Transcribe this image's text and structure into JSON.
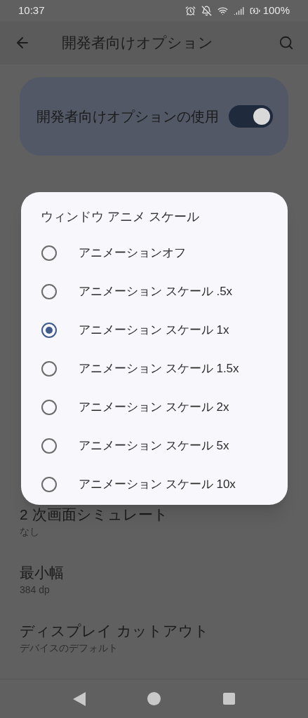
{
  "status_bar": {
    "time": "10:37",
    "battery": "100%"
  },
  "app_bar": {
    "title": "開発者向けオプション"
  },
  "main_switch": {
    "label": "開発者向けオプションの使用",
    "on": true
  },
  "settings": [
    {
      "title": "2 次画面シミュレート",
      "summary": "なし"
    },
    {
      "title": "最小幅",
      "summary": "384 dp"
    },
    {
      "title": "ディスプレイ カットアウト",
      "summary": "デバイスのデフォルト"
    }
  ],
  "dialog": {
    "title": "ウィンドウ アニメ スケール",
    "options": [
      {
        "label": "アニメーションオフ",
        "selected": false
      },
      {
        "label": "アニメーション スケール .5x",
        "selected": false
      },
      {
        "label": "アニメーション スケール 1x",
        "selected": true
      },
      {
        "label": "アニメーション スケール 1.5x",
        "selected": false
      },
      {
        "label": "アニメーション スケール 2x",
        "selected": false
      },
      {
        "label": "アニメーション スケール 5x",
        "selected": false
      },
      {
        "label": "アニメーション スケール 10x",
        "selected": false
      }
    ]
  }
}
